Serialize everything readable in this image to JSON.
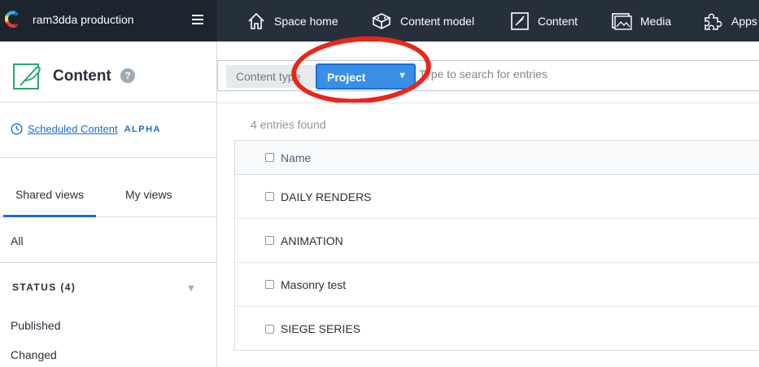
{
  "topbar": {
    "space_name": "ram3dda production",
    "nav": [
      {
        "label": "Space home",
        "icon": "home-icon"
      },
      {
        "label": "Content model",
        "icon": "content-model-icon"
      },
      {
        "label": "Content",
        "icon": "content-icon"
      },
      {
        "label": "Media",
        "icon": "media-icon"
      },
      {
        "label": "Apps",
        "icon": "apps-icon"
      }
    ]
  },
  "sidebar": {
    "title": "Content",
    "help": "?",
    "scheduled_link": "Scheduled Content",
    "alpha_badge": "ALPHA",
    "tabs": [
      "Shared views",
      "My views"
    ],
    "all_label": "All",
    "status_heading": "STATUS (4)",
    "status_items": [
      "Published",
      "Changed"
    ]
  },
  "search": {
    "content_type_label": "Content type",
    "content_type_value": "Project",
    "placeholder": "Type to search for entries"
  },
  "entries": {
    "count_text": "4 entries found",
    "column_name": "Name",
    "rows": [
      "DAILY RENDERS",
      "ANIMATION",
      "Masonry test",
      "SIEGE SERIES"
    ]
  },
  "colors": {
    "topbar_bg": "#26303d",
    "space_bg": "#1c242e",
    "accent_blue": "#1a6ed6",
    "highlight_red": "#e8271a",
    "content_icon_green": "#2aa66e"
  }
}
